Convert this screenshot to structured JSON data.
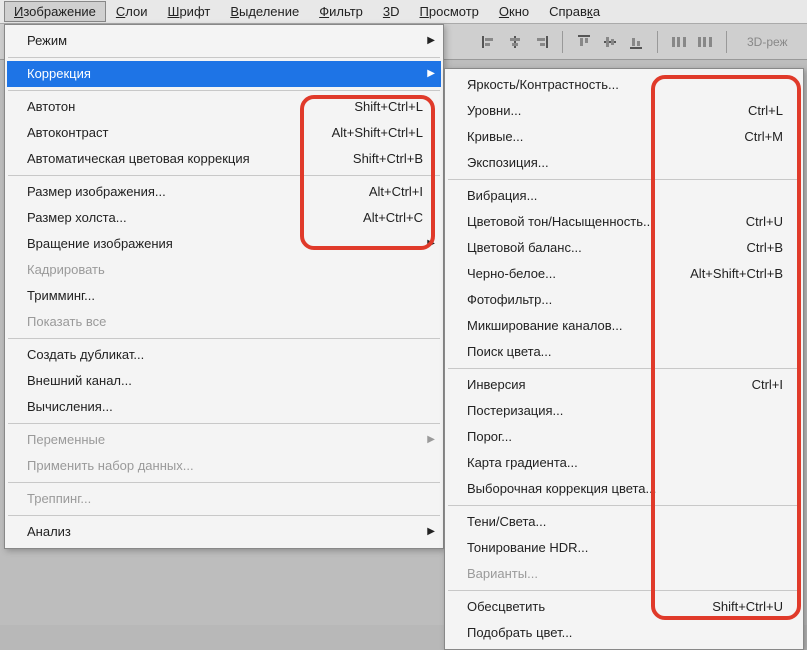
{
  "menubar": {
    "items": [
      {
        "label": "Изображение",
        "mnemonic": 0
      },
      {
        "label": "Слои",
        "mnemonic": 0
      },
      {
        "label": "Шрифт",
        "mnemonic": 0
      },
      {
        "label": "Выделение",
        "mnemonic": 0
      },
      {
        "label": "Фильтр",
        "mnemonic": 0
      },
      {
        "label": "3D",
        "mnemonic": 0
      },
      {
        "label": "Просмотр",
        "mnemonic": 0
      },
      {
        "label": "Окно",
        "mnemonic": 0
      },
      {
        "label": "Справка",
        "mnemonic": 5
      }
    ]
  },
  "toolbar": {
    "mode_label": "3D-реж"
  },
  "menu_main": [
    {
      "type": "item",
      "label": "Режим",
      "arrow": true
    },
    {
      "type": "sep"
    },
    {
      "type": "item",
      "label": "Коррекция",
      "arrow": true,
      "highlight": true
    },
    {
      "type": "sep"
    },
    {
      "type": "item",
      "label": "Автотон",
      "shortcut": "Shift+Ctrl+L"
    },
    {
      "type": "item",
      "label": "Автоконтраст",
      "shortcut": "Alt+Shift+Ctrl+L"
    },
    {
      "type": "item",
      "label": "Автоматическая цветовая коррекция",
      "shortcut": "Shift+Ctrl+B"
    },
    {
      "type": "sep"
    },
    {
      "type": "item",
      "label": "Размер изображения...",
      "shortcut": "Alt+Ctrl+I"
    },
    {
      "type": "item",
      "label": "Размер холста...",
      "shortcut": "Alt+Ctrl+C"
    },
    {
      "type": "item",
      "label": "Вращение изображения",
      "arrow": true
    },
    {
      "type": "item",
      "label": "Кадрировать",
      "disabled": true
    },
    {
      "type": "item",
      "label": "Тримминг..."
    },
    {
      "type": "item",
      "label": "Показать все",
      "disabled": true
    },
    {
      "type": "sep"
    },
    {
      "type": "item",
      "label": "Создать дубликат..."
    },
    {
      "type": "item",
      "label": "Внешний канал..."
    },
    {
      "type": "item",
      "label": "Вычисления..."
    },
    {
      "type": "sep"
    },
    {
      "type": "item",
      "label": "Переменные",
      "arrow": true,
      "disabled": true
    },
    {
      "type": "item",
      "label": "Применить набор данных...",
      "disabled": true
    },
    {
      "type": "sep"
    },
    {
      "type": "item",
      "label": "Треппинг...",
      "disabled": true
    },
    {
      "type": "sep"
    },
    {
      "type": "item",
      "label": "Анализ",
      "arrow": true
    }
  ],
  "menu_sub": [
    {
      "type": "item",
      "label": "Яркость/Контрастность..."
    },
    {
      "type": "item",
      "label": "Уровни...",
      "shortcut": "Ctrl+L"
    },
    {
      "type": "item",
      "label": "Кривые...",
      "shortcut": "Ctrl+M"
    },
    {
      "type": "item",
      "label": "Экспозиция..."
    },
    {
      "type": "sep"
    },
    {
      "type": "item",
      "label": "Вибрация..."
    },
    {
      "type": "item",
      "label": "Цветовой тон/Насыщенность...",
      "shortcut": "Ctrl+U"
    },
    {
      "type": "item",
      "label": "Цветовой баланс...",
      "shortcut": "Ctrl+B"
    },
    {
      "type": "item",
      "label": "Черно-белое...",
      "shortcut": "Alt+Shift+Ctrl+B"
    },
    {
      "type": "item",
      "label": "Фотофильтр..."
    },
    {
      "type": "item",
      "label": "Микширование каналов..."
    },
    {
      "type": "item",
      "label": "Поиск цвета..."
    },
    {
      "type": "sep"
    },
    {
      "type": "item",
      "label": "Инверсия",
      "shortcut": "Ctrl+I"
    },
    {
      "type": "item",
      "label": "Постеризация..."
    },
    {
      "type": "item",
      "label": "Порог..."
    },
    {
      "type": "item",
      "label": "Карта градиента..."
    },
    {
      "type": "item",
      "label": "Выборочная коррекция цвета..."
    },
    {
      "type": "sep"
    },
    {
      "type": "item",
      "label": "Тени/Света..."
    },
    {
      "type": "item",
      "label": "Тонирование HDR..."
    },
    {
      "type": "item",
      "label": "Варианты...",
      "disabled": true
    },
    {
      "type": "sep"
    },
    {
      "type": "item",
      "label": "Обесцветить",
      "shortcut": "Shift+Ctrl+U"
    },
    {
      "type": "item",
      "label": "Подобрать цвет..."
    }
  ]
}
